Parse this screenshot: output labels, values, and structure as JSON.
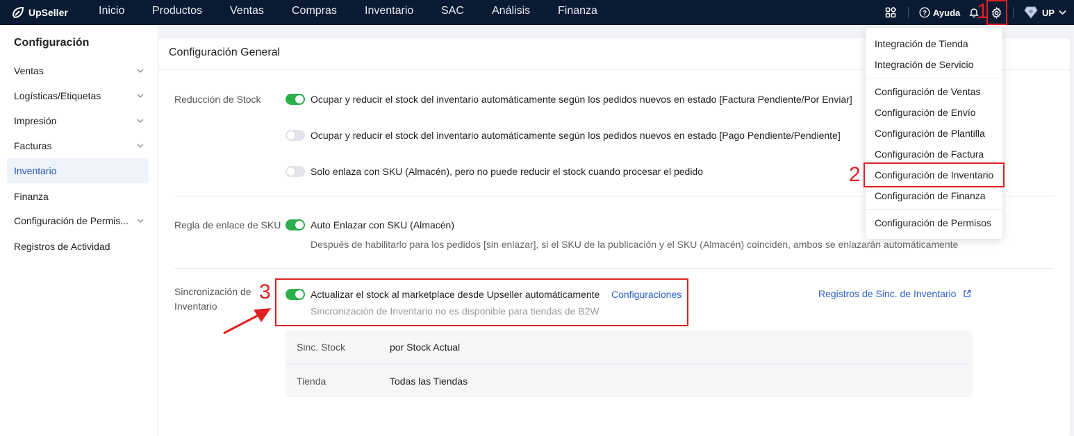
{
  "brand": {
    "name": "UpSeller"
  },
  "nav": [
    "Inicio",
    "Productos",
    "Ventas",
    "Compras",
    "Inventario",
    "SAC",
    "Análisis",
    "Finanza"
  ],
  "topbar": {
    "help_label": "Ayuda",
    "user_label": "UP"
  },
  "annotations": {
    "n1": "1",
    "n2": "2",
    "n3": "3",
    "color": "#e02020"
  },
  "sidebar": {
    "title": "Configuración",
    "items": [
      {
        "label": "Ventas",
        "expandable": true
      },
      {
        "label": "Logísticas/Etiquetas",
        "expandable": true
      },
      {
        "label": "Impresión",
        "expandable": true
      },
      {
        "label": "Facturas",
        "expandable": true
      },
      {
        "label": "Inventario",
        "expandable": false,
        "active": true
      },
      {
        "label": "Finanza",
        "expandable": false
      },
      {
        "label": "Configuración de Permis...",
        "expandable": true
      },
      {
        "label": "Registros de Actividad",
        "expandable": false
      }
    ]
  },
  "main": {
    "title": "Configuración General",
    "stock_reduction": {
      "label": "Reducción de Stock",
      "options": [
        {
          "text": "Ocupar y reducir el stock del inventario automáticamente según los pedidos nuevos en estado [Factura Pendiente/Por Enviar]",
          "enabled": true
        },
        {
          "text": "Ocupar y reducir el stock del inventario automáticamente según los pedidos nuevos en estado [Pago Pendiente/Pendiente]",
          "enabled": false
        },
        {
          "text": "Solo enlaza con SKU (Almacén), pero no puede reducir el stock cuando procesar el pedido",
          "enabled": false
        }
      ]
    },
    "sku_link": {
      "label": "Regla de enlace de SKU",
      "option": "Auto Enlazar con SKU (Almacén)",
      "enabled": true,
      "description": "Después de habilitarlo para los pedidos [sin enlazar], si el SKU de la publicación y el SKU (Almacén) coinciden, ambos se enlazarán automáticamente"
    },
    "inventory_sync": {
      "label_line1": "Sincronización de",
      "label_line2": "Inventario",
      "option": "Actualizar el stock al marketplace desde Upseller automáticamente",
      "enabled": true,
      "config_link": "Configuraciones",
      "note": "Sincronización de Inventario no es disponible para tiendas de B2W",
      "records_link": "Registros de Sinc. de Inventario",
      "table": [
        {
          "label": "Sinc. Stock",
          "value": "por Stock Actual"
        },
        {
          "label": "Tienda",
          "value": "Todas las Tiendas"
        }
      ]
    }
  },
  "settings_menu": {
    "items": [
      "Integración de Tienda",
      "Integración de Servicio",
      "Configuración de Ventas",
      "Configuración de Envío",
      "Configuración de Plantilla",
      "Configuración de Factura",
      "Configuración de Inventario",
      "Configuración de Finanza",
      "Configuración de Permisos"
    ]
  },
  "colors": {
    "topbar": "#0b1a33",
    "accent": "#2b5fc9",
    "toggle_on": "#2bb04c",
    "annotation": "#e02020"
  }
}
